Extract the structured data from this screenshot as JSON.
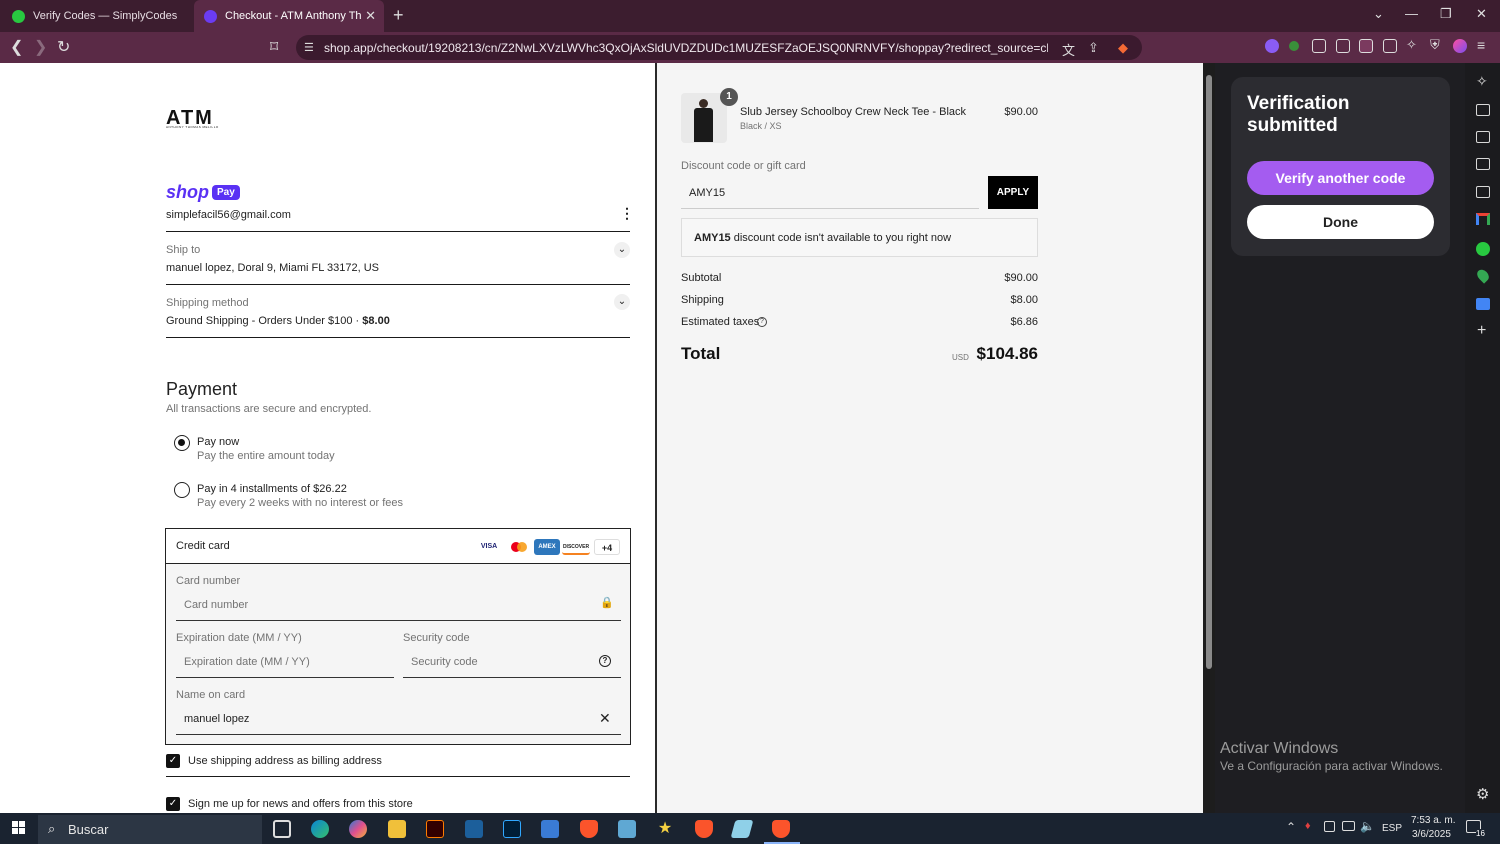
{
  "browser": {
    "tabs": [
      {
        "title": "Verify Codes — SimplyCodes"
      },
      {
        "title": "Checkout - ATM Anthony Thoma"
      }
    ],
    "url": "shop.app/checkout/19208213/cn/Z2NwLXVzLWVhc3QxOjAxSldUVDZDUDc1MUZESFZaOEJSQ0NRNVFY/shoppay?redirect_source=checkout_universa..."
  },
  "checkout": {
    "brand": "ATM",
    "brand_sub": "ANTHONY THOMAS MELILLO",
    "shop_label": "shop",
    "pay_label": "Pay",
    "email": "simplefacil56@gmail.com",
    "ship_to_label": "Ship to",
    "ship_to_value": "manuel lopez, Doral 9, Miami FL 33172, US",
    "shipping_method_label": "Shipping method",
    "shipping_method_value": "Ground Shipping - Orders Under $100 · ",
    "shipping_method_price": "$8.00",
    "payment_title": "Payment",
    "payment_subtitle": "All transactions are secure and encrypted.",
    "options": [
      {
        "label": "Pay now",
        "sub": "Pay the entire amount today",
        "selected": true
      },
      {
        "label": "Pay in 4 installments of $26.22",
        "sub": "Pay every 2 weeks with no interest or fees",
        "selected": false
      }
    ],
    "credit_card_label": "Credit card",
    "card_logos": [
      "VISA",
      "MC",
      "AMEX",
      "DISCOVER",
      "+4"
    ],
    "card_number_label": "Card number",
    "card_number_placeholder": "Card number",
    "expiration_label": "Expiration date (MM / YY)",
    "expiration_placeholder": "Expiration date (MM / YY)",
    "security_label": "Security code",
    "security_placeholder": "Security code",
    "name_label": "Name on card",
    "name_value": "manuel lopez",
    "billing_checkbox": "Use shipping address as billing address",
    "news_checkbox": "Sign me up for news and offers from this store"
  },
  "summary": {
    "item_qty": "1",
    "item_name": "Slub Jersey Schoolboy Crew Neck Tee - Black",
    "item_variant": "Black / XS",
    "item_price": "$90.00",
    "discount_label": "Discount code or gift card",
    "discount_value": "AMY15",
    "apply_label": "APPLY",
    "discount_code": "AMY15",
    "discount_error": " discount code isn't available to you right now",
    "subtotal_label": "Subtotal",
    "subtotal_value": "$90.00",
    "shipping_label": "Shipping",
    "shipping_value": "$8.00",
    "taxes_label": "Estimated taxes",
    "taxes_value": "$6.86",
    "total_label": "Total",
    "total_currency": "USD",
    "total_value": "$104.86"
  },
  "side_panel": {
    "title": "Verification submitted",
    "verify_button": "Verify another code",
    "done_button": "Done"
  },
  "watermark": {
    "line1": "Activar Windows",
    "line2": "Ve a Configuración para activar Windows."
  },
  "taskbar": {
    "search": "Buscar",
    "lang": "ESP",
    "time": "7:53 a. m.",
    "date": "3/6/2025",
    "notif_count": "16"
  }
}
